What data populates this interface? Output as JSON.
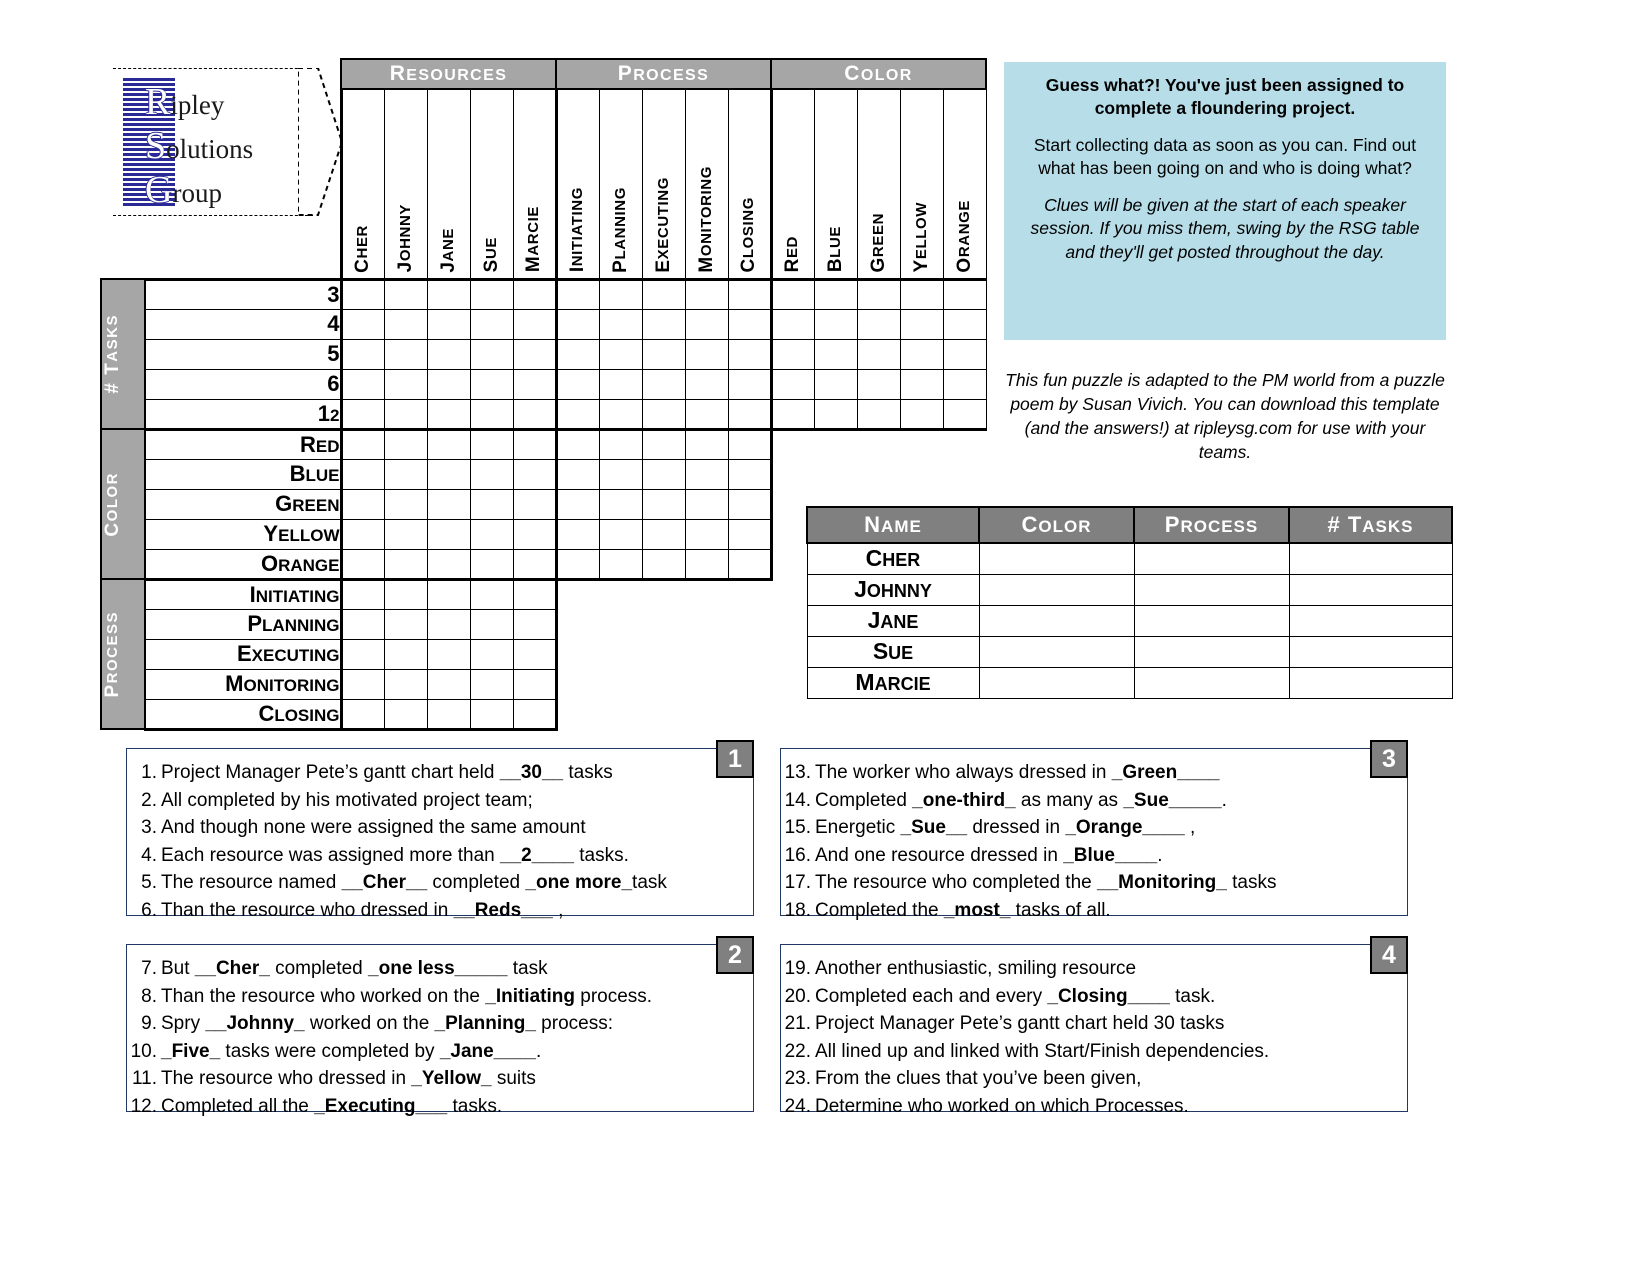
{
  "logo": {
    "line1_cap": "R",
    "line1_rest": "ipley",
    "line2_cap": "S",
    "line2_rest": "olutions",
    "line3_cap": "G",
    "line3_rest": "roup"
  },
  "grid": {
    "col_categories": [
      "Resources",
      "Process",
      "Color"
    ],
    "columns": {
      "resources": [
        "Cher",
        "Johnny",
        "Jane",
        "Sue",
        "Marcie"
      ],
      "process": [
        "Initiating",
        "Planning",
        "Executing",
        "Monitoring",
        "Closing"
      ],
      "color": [
        "Red",
        "Blue",
        "Green",
        "Yellow",
        "Orange"
      ]
    },
    "row_blocks": [
      {
        "category": "# Tasks",
        "rows": [
          "3",
          "4",
          "5",
          "6",
          "12"
        ],
        "cols": 15
      },
      {
        "category": "Color",
        "rows": [
          "Red",
          "Blue",
          "Green",
          "Yellow",
          "Orange"
        ],
        "cols": 10
      },
      {
        "category": "Process",
        "rows": [
          "Initiating",
          "Planning",
          "Executing",
          "Monitoring",
          "Closing"
        ],
        "cols": 5
      }
    ]
  },
  "infobox": {
    "headline": "Guess what?! You've just been assigned to complete a floundering project.",
    "body": "Start collecting data as soon as you can.  Find out what has been going on and who is doing what?",
    "note": "Clues will be given at the start of each speaker session.  If you miss them, swing by the RSG table and they'll get posted throughout the day.",
    "bg_color": "#b7dee8"
  },
  "credit": "This fun puzzle is adapted to the PM world from a puzzle poem by Susan Vivich.  You can download this template (and the answers!) at ripleysg.com for use with your teams.",
  "answer_table": {
    "headers": [
      "Name",
      "Color",
      "Process",
      "# Tasks"
    ],
    "rows": [
      {
        "name": "Cher",
        "color": "",
        "process": "",
        "tasks": ""
      },
      {
        "name": "Johnny",
        "color": "",
        "process": "",
        "tasks": ""
      },
      {
        "name": "Jane",
        "color": "",
        "process": "",
        "tasks": ""
      },
      {
        "name": "Sue",
        "color": "",
        "process": "",
        "tasks": ""
      },
      {
        "name": "Marcie",
        "color": "",
        "process": "",
        "tasks": ""
      }
    ]
  },
  "clue_boxes": [
    {
      "badge": "1",
      "clues": [
        {
          "num": "1.",
          "html": "Project Manager Pete’s gantt chart held <b>__30__</b> tasks"
        },
        {
          "num": "2.",
          "html": "All completed by his motivated project team;"
        },
        {
          "num": "3.",
          "html": "And though none were assigned the same amount"
        },
        {
          "num": "4.",
          "html": "Each resource was assigned more than <b>__2____</b> tasks."
        },
        {
          "num": "5.",
          "html": "The resource named <b>__Cher__</b> completed <b>_one more_</b>task"
        },
        {
          "num": "6.",
          "html": "Than the resource who dressed in <b>__Reds___</b> ,"
        }
      ]
    },
    {
      "badge": "2",
      "clues": [
        {
          "num": "7.",
          "html": "But <b>__Cher_</b> completed <b>_one less_____</b> task"
        },
        {
          "num": "8.",
          "html": "Than the resource who worked on the <b>_Initiating</b> process."
        },
        {
          "num": "9.",
          "html": "Spry <b>__Johnny_</b> worked on the <b>_Planning_</b> process:"
        },
        {
          "num": "10.",
          "html": "<b>_Five_</b> tasks were completed by <b>_Jane____</b>."
        },
        {
          "num": "11.",
          "html": "The resource who dressed in <b>_Yellow_</b> suits"
        },
        {
          "num": "12.",
          "html": "Completed all the <b>_Executing___</b> tasks."
        }
      ]
    },
    {
      "badge": "3",
      "clues": [
        {
          "num": "13.",
          "html": "The worker who always dressed in <b>_Green____</b>"
        },
        {
          "num": "14.",
          "html": "Completed <b>_one-third_</b> as many as <b>_Sue_____</b>."
        },
        {
          "num": "15.",
          "html": "Energetic <b>_Sue__</b> dressed in <b>_Orange____</b> ,"
        },
        {
          "num": "16.",
          "html": "And one resource dressed in <b>_Blue____</b>."
        },
        {
          "num": "17.",
          "html": "The resource who completed the <b>__Monitoring_</b> tasks"
        },
        {
          "num": "18.",
          "html": "Completed the <b>_most_</b> tasks of all."
        }
      ]
    },
    {
      "badge": "4",
      "clues": [
        {
          "num": "19.",
          "html": "Another enthusiastic, smiling resource"
        },
        {
          "num": "20.",
          "html": "Completed each and every <b>_Closing____</b> task."
        },
        {
          "num": "21.",
          "html": "Project Manager Pete’s gantt chart held 30 tasks"
        },
        {
          "num": "22.",
          "html": "All lined up and linked with Start/Finish dependencies."
        },
        {
          "num": "23.",
          "html": "From the clues that you’ve been given,"
        },
        {
          "num": "24.",
          "html": "Determine who worked on which Processes."
        }
      ]
    }
  ]
}
